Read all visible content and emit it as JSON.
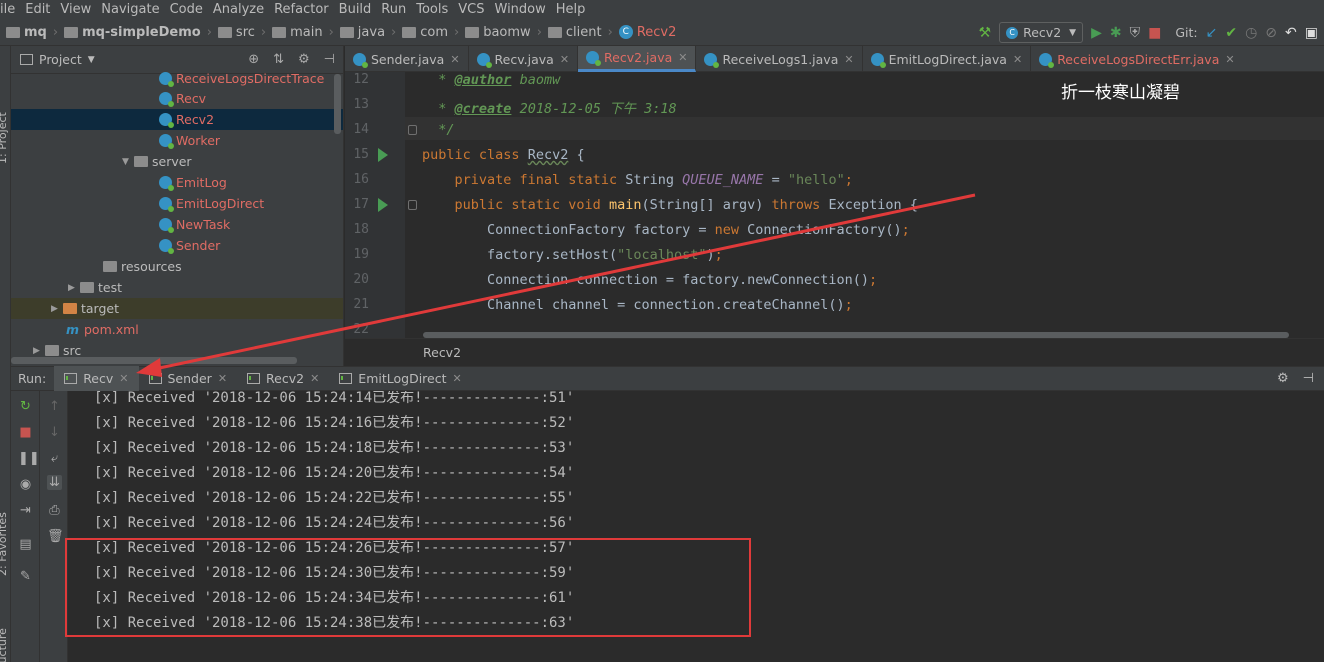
{
  "menu": [
    "ile",
    "Edit",
    "View",
    "Navigate",
    "Code",
    "Analyze",
    "Refactor",
    "Build",
    "Run",
    "Tools",
    "VCS",
    "Window",
    "Help"
  ],
  "breadcrumbs": [
    "mq",
    "mq-simpleDemo",
    "src",
    "main",
    "java",
    "com",
    "baomw",
    "client",
    "Recv2"
  ],
  "run_config": "Recv2",
  "git_label": "Git:",
  "project_panel": {
    "title": "Project",
    "stripe_label": "1: Project",
    "tree": [
      {
        "label": "ReceiveLogsDirectTrace",
        "kind": "class"
      },
      {
        "label": "Recv",
        "kind": "class"
      },
      {
        "label": "Recv2",
        "kind": "class",
        "selected": true
      },
      {
        "label": "Worker",
        "kind": "class"
      },
      {
        "label": "server",
        "kind": "folder"
      },
      {
        "label": "EmitLog",
        "kind": "class"
      },
      {
        "label": "EmitLogDirect",
        "kind": "class"
      },
      {
        "label": "NewTask",
        "kind": "class"
      },
      {
        "label": "Sender",
        "kind": "class"
      },
      {
        "label": "resources",
        "kind": "folder"
      },
      {
        "label": "test",
        "kind": "folder"
      },
      {
        "label": "target",
        "kind": "folder"
      },
      {
        "label": "pom.xml",
        "kind": "maven"
      },
      {
        "label": "src",
        "kind": "folder"
      }
    ]
  },
  "editor_tabs": [
    {
      "label": "Sender.java",
      "active": false
    },
    {
      "label": "Recv.java",
      "active": false
    },
    {
      "label": "Recv2.java",
      "active": true
    },
    {
      "label": "ReceiveLogs1.java",
      "active": false
    },
    {
      "label": "EmitLogDirect.java",
      "active": false
    },
    {
      "label": "ReceiveLogsDirectErr.java",
      "active": false
    }
  ],
  "watermark": "折一枝寒山凝碧",
  "code": {
    "line_numbers": [
      "12",
      "13",
      "14",
      "15",
      "16",
      "17",
      "18",
      "19",
      "20",
      "21",
      "22"
    ],
    "l12_tag": "@author",
    "l12_val": "baomw",
    "l13_tag": "@create",
    "l13_val": "2018-12-05 下午 3:18",
    "l14": "*/",
    "l15_kw": "public class",
    "l15_name": "Recv2",
    "l15_brace": "{",
    "l16_kw": "private final static",
    "l16_type": "String",
    "l16_field": "QUEUE_NAME",
    "l16_eq": "=",
    "l16_str": "\"hello\"",
    "l16_semi": ";",
    "l17_kw": "public static void",
    "l17_fn": "main",
    "l17_params": "(String[] argv)",
    "l17_throws": "throws",
    "l17_exc": "Exception {",
    "l18_a": "ConnectionFactory factory =",
    "l18_kw": "new",
    "l18_b": "ConnectionFactory()",
    "l18_semi": ";",
    "l19_a": "factory.setHost(",
    "l19_str": "\"localhost\"",
    "l19_b": ")",
    "l19_semi": ";",
    "l20_a": "Connection connection = factory.newConnection()",
    "l20_semi": ";",
    "l21_a": "Channel channel = connection.createChannel()",
    "l21_semi": ";"
  },
  "editor_breadcrumb": "Recv2",
  "run_panel": {
    "label": "Run:",
    "tabs": [
      {
        "label": "Recv",
        "active": true
      },
      {
        "label": "Sender",
        "active": false
      },
      {
        "label": "Recv2",
        "active": false
      },
      {
        "label": "EmitLogDirect",
        "active": false
      }
    ],
    "stripe_favorites": "2: Favorites",
    "stripe_structure": "Z: Structure"
  },
  "console_lines": [
    "[x] Received '2018-12-06 15:24:14已发布!--------------:51'",
    "[x] Received '2018-12-06 15:24:16已发布!--------------:52'",
    "[x] Received '2018-12-06 15:24:18已发布!--------------:53'",
    "[x] Received '2018-12-06 15:24:20已发布!--------------:54'",
    "[x] Received '2018-12-06 15:24:22已发布!--------------:55'",
    "[x] Received '2018-12-06 15:24:24已发布!--------------:56'",
    "[x] Received '2018-12-06 15:24:26已发布!--------------:57'",
    "[x] Received '2018-12-06 15:24:30已发布!--------------:59'",
    "[x] Received '2018-12-06 15:24:34已发布!--------------:61'",
    "[x] Received '2018-12-06 15:24:38已发布!--------------:63'"
  ],
  "colors": {
    "annotation_red": "#e03a3a",
    "background": "#2b2b2b",
    "panel": "#3c3f41",
    "keyword": "#cc7832",
    "string": "#6a8759",
    "class_icon": "#3592c4"
  }
}
